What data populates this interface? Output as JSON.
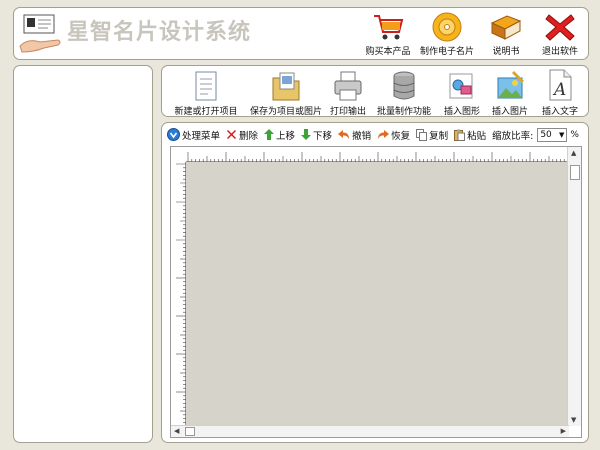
{
  "header": {
    "brand": "星智名片设计系统",
    "buttons": [
      {
        "label": "购买本产品",
        "icon": "cart-icon"
      },
      {
        "label": "制作电子名片",
        "icon": "disc-icon"
      },
      {
        "label": "说明书",
        "icon": "book-icon"
      },
      {
        "label": "退出软件",
        "icon": "close-icon"
      }
    ]
  },
  "tools": [
    {
      "label": "新建或打开项目",
      "icon": "document-icon"
    },
    {
      "label": "保存为项目或图片",
      "icon": "save-folder-icon"
    },
    {
      "label": "打印输出",
      "icon": "printer-icon"
    },
    {
      "label": "批量制作功能",
      "icon": "database-icon"
    },
    {
      "label": "插入图形",
      "icon": "shapes-icon"
    },
    {
      "label": "插入图片",
      "icon": "picture-icon"
    },
    {
      "label": "插入文字",
      "icon": "text-icon"
    }
  ],
  "editbar": {
    "menu": "处理菜单",
    "delete": "删除",
    "up": "上移",
    "down": "下移",
    "undo": "撤销",
    "redo": "恢复",
    "copy": "复制",
    "paste": "粘贴",
    "zoom_label": "缩放比率:",
    "zoom_value": "50",
    "percent": "%"
  },
  "colors": {
    "background": "#e9e6dc",
    "canvas": "#d6d3ca",
    "border": "#a59f8e"
  }
}
